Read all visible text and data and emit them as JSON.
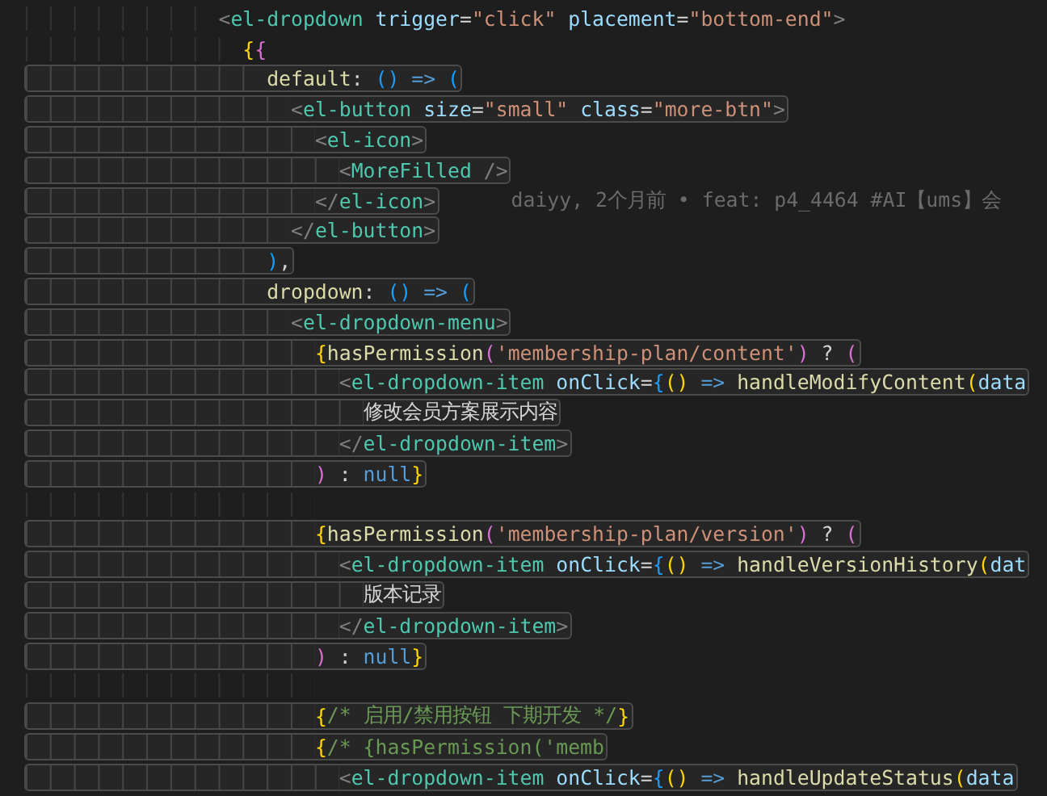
{
  "editor": {
    "lines": [
      {
        "boxed": false,
        "tokens": [
          {
            "text": "                  <",
            "kind": "angle"
          },
          {
            "text": "el-dropdown",
            "kind": "tag"
          },
          {
            "text": " trigger",
            "kind": "attr"
          },
          {
            "text": "=",
            "kind": "plain"
          },
          {
            "text": "\"click\"",
            "kind": "string"
          },
          {
            "text": " placement",
            "kind": "attr"
          },
          {
            "text": "=",
            "kind": "plain"
          },
          {
            "text": "\"bottom-end\"",
            "kind": "string"
          },
          {
            "text": ">",
            "kind": "angle"
          }
        ]
      },
      {
        "boxed": false,
        "tokens": [
          {
            "text": "                    {",
            "kind": "gold"
          },
          {
            "text": "{",
            "kind": "purple"
          }
        ]
      },
      {
        "boxed": true,
        "tokens": [
          {
            "text": "                      default",
            "kind": "func"
          },
          {
            "text": ": ",
            "kind": "plain"
          },
          {
            "text": "()",
            "kind": "blue"
          },
          {
            "text": " => ",
            "kind": "keyword"
          },
          {
            "text": "(",
            "kind": "blue"
          }
        ]
      },
      {
        "boxed": true,
        "tokens": [
          {
            "text": "                        <",
            "kind": "angle"
          },
          {
            "text": "el-button",
            "kind": "tag"
          },
          {
            "text": " size",
            "kind": "attr"
          },
          {
            "text": "=",
            "kind": "plain"
          },
          {
            "text": "\"small\"",
            "kind": "string"
          },
          {
            "text": " class",
            "kind": "attr"
          },
          {
            "text": "=",
            "kind": "plain"
          },
          {
            "text": "\"more-btn\"",
            "kind": "string"
          },
          {
            "text": ">",
            "kind": "angle"
          }
        ]
      },
      {
        "boxed": true,
        "tokens": [
          {
            "text": "                          <",
            "kind": "angle"
          },
          {
            "text": "el-icon",
            "kind": "tag"
          },
          {
            "text": ">",
            "kind": "angle"
          }
        ]
      },
      {
        "boxed": true,
        "tokens": [
          {
            "text": "                            <",
            "kind": "angle"
          },
          {
            "text": "MoreFilled",
            "kind": "tag"
          },
          {
            "text": " />",
            "kind": "angle"
          }
        ]
      },
      {
        "boxed": true,
        "tokens": [
          {
            "text": "                          </",
            "kind": "angle"
          },
          {
            "text": "el-icon",
            "kind": "tag"
          },
          {
            "text": ">",
            "kind": "angle"
          }
        ],
        "blame": "daiyy, 2个月前 • feat: p4_4464 #AI【ums】会"
      },
      {
        "boxed": true,
        "tokens": [
          {
            "text": "                        </",
            "kind": "angle"
          },
          {
            "text": "el-button",
            "kind": "tag"
          },
          {
            "text": ">",
            "kind": "angle"
          }
        ]
      },
      {
        "boxed": true,
        "tokens": [
          {
            "text": "                      )",
            "kind": "blue"
          },
          {
            "text": ",",
            "kind": "plain"
          }
        ]
      },
      {
        "boxed": true,
        "tokens": [
          {
            "text": "                      dropdown",
            "kind": "func"
          },
          {
            "text": ": ",
            "kind": "plain"
          },
          {
            "text": "()",
            "kind": "blue"
          },
          {
            "text": " => ",
            "kind": "keyword"
          },
          {
            "text": "(",
            "kind": "blue"
          }
        ]
      },
      {
        "boxed": true,
        "tokens": [
          {
            "text": "                        <",
            "kind": "angle"
          },
          {
            "text": "el-dropdown-menu",
            "kind": "tag"
          },
          {
            "text": ">",
            "kind": "angle"
          }
        ]
      },
      {
        "boxed": true,
        "tokens": [
          {
            "text": "                          {",
            "kind": "gold"
          },
          {
            "text": "hasPermission",
            "kind": "func"
          },
          {
            "text": "(",
            "kind": "purple"
          },
          {
            "text": "'membership-plan/content'",
            "kind": "string"
          },
          {
            "text": ")",
            "kind": "purple"
          },
          {
            "text": " ? ",
            "kind": "plain"
          },
          {
            "text": "(",
            "kind": "purple"
          }
        ]
      },
      {
        "boxed": true,
        "tokens": [
          {
            "text": "                            <",
            "kind": "angle"
          },
          {
            "text": "el-dropdown-item",
            "kind": "tag"
          },
          {
            "text": " onClick",
            "kind": "attr"
          },
          {
            "text": "=",
            "kind": "plain"
          },
          {
            "text": "{",
            "kind": "blue"
          },
          {
            "text": "()",
            "kind": "gold"
          },
          {
            "text": " => ",
            "kind": "keyword"
          },
          {
            "text": "handleModifyContent",
            "kind": "func"
          },
          {
            "text": "(",
            "kind": "gold"
          },
          {
            "text": "data",
            "kind": "attr"
          }
        ]
      },
      {
        "boxed": true,
        "tokens": [
          {
            "text": "                              修改会员方案展示内容",
            "kind": "plain"
          }
        ]
      },
      {
        "boxed": true,
        "tokens": [
          {
            "text": "                            </",
            "kind": "angle"
          },
          {
            "text": "el-dropdown-item",
            "kind": "tag"
          },
          {
            "text": ">",
            "kind": "angle"
          }
        ]
      },
      {
        "boxed": true,
        "tokens": [
          {
            "text": "                          )",
            "kind": "purple"
          },
          {
            "text": " : ",
            "kind": "plain"
          },
          {
            "text": "null",
            "kind": "keyword"
          },
          {
            "text": "}",
            "kind": "gold"
          }
        ]
      },
      {
        "boxed": false
      },
      {
        "boxed": true,
        "tokens": [
          {
            "text": "                          {",
            "kind": "gold"
          },
          {
            "text": "hasPermission",
            "kind": "func"
          },
          {
            "text": "(",
            "kind": "purple"
          },
          {
            "text": "'membership-plan/version'",
            "kind": "string"
          },
          {
            "text": ")",
            "kind": "purple"
          },
          {
            "text": " ? ",
            "kind": "plain"
          },
          {
            "text": "(",
            "kind": "purple"
          }
        ]
      },
      {
        "boxed": true,
        "tokens": [
          {
            "text": "                            <",
            "kind": "angle"
          },
          {
            "text": "el-dropdown-item",
            "kind": "tag"
          },
          {
            "text": " onClick",
            "kind": "attr"
          },
          {
            "text": "=",
            "kind": "plain"
          },
          {
            "text": "{",
            "kind": "blue"
          },
          {
            "text": "()",
            "kind": "gold"
          },
          {
            "text": " => ",
            "kind": "keyword"
          },
          {
            "text": "handleVersionHistory",
            "kind": "func"
          },
          {
            "text": "(",
            "kind": "gold"
          },
          {
            "text": "dat",
            "kind": "attr"
          }
        ]
      },
      {
        "boxed": true,
        "tokens": [
          {
            "text": "                              版本记录",
            "kind": "plain"
          }
        ]
      },
      {
        "boxed": true,
        "tokens": [
          {
            "text": "                            </",
            "kind": "angle"
          },
          {
            "text": "el-dropdown-item",
            "kind": "tag"
          },
          {
            "text": ">",
            "kind": "angle"
          }
        ]
      },
      {
        "boxed": true,
        "tokens": [
          {
            "text": "                          )",
            "kind": "purple"
          },
          {
            "text": " : ",
            "kind": "plain"
          },
          {
            "text": "null",
            "kind": "keyword"
          },
          {
            "text": "}",
            "kind": "gold"
          }
        ]
      },
      {
        "boxed": false
      },
      {
        "boxed": true,
        "tokens": [
          {
            "text": "                          {",
            "kind": "gold"
          },
          {
            "text": "/* 启用/禁用按钮 下期开发 */",
            "kind": "comment"
          },
          {
            "text": "}",
            "kind": "gold"
          }
        ]
      },
      {
        "boxed": true,
        "tokens": [
          {
            "text": "                          {",
            "kind": "gold"
          },
          {
            "text": "/* {hasPermission('memb",
            "kind": "comment"
          }
        ]
      },
      {
        "boxed": true,
        "tokens": [
          {
            "text": "                            <",
            "kind": "angle"
          },
          {
            "text": "el-dropdown-item",
            "kind": "tag"
          },
          {
            "text": " onClick",
            "kind": "attr"
          },
          {
            "text": "=",
            "kind": "plain"
          },
          {
            "text": "{",
            "kind": "blue"
          },
          {
            "text": "()",
            "kind": "gold"
          },
          {
            "text": " => ",
            "kind": "keyword"
          },
          {
            "text": "handleUpdateStatus",
            "kind": "func"
          },
          {
            "text": "(",
            "kind": "gold"
          },
          {
            "text": "data",
            "kind": "attr"
          }
        ]
      }
    ]
  }
}
